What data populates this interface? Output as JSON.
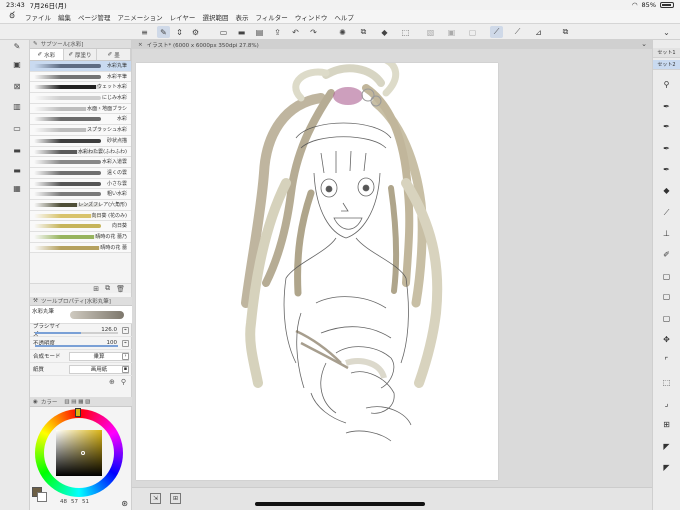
{
  "status_bar": {
    "time": "23:43",
    "date": "7月26日(月)",
    "battery": "85%",
    "wifi_icon": "wifi-icon",
    "battery_icon": "battery-icon"
  },
  "menu": {
    "items": [
      "ファイル",
      "編集",
      "ページ管理",
      "アニメーション",
      "レイヤー",
      "選択範囲",
      "表示",
      "フィルター",
      "ウィンドウ",
      "ヘルプ"
    ]
  },
  "command_bar": {
    "icons": [
      "menu-icon",
      "brush-tool-icon",
      "up-down-icon",
      "settings-icon",
      "new-file-icon",
      "open-folder-icon",
      "save-icon",
      "export-icon",
      "undo-icon",
      "redo-icon",
      "sun-icon",
      "copy-icon",
      "fill-icon",
      "transform-icon",
      "deselect-icon",
      "deselect-icon",
      "crop-icon",
      "pen-icon",
      "pen-icon",
      "ruler-icon",
      "link-icon"
    ]
  },
  "left_tools": [
    "pen-icon",
    "layer-icon",
    "close-box-icon",
    "file-icon",
    "square-icon",
    "folder-icon",
    "folder-icon",
    "gallery-icon"
  ],
  "subtool_panel": {
    "header": "サブツール[水彩]",
    "tabs": [
      {
        "label": "水彩",
        "icon": "brush-icon"
      },
      {
        "label": "厚塗り",
        "icon": "brush-icon"
      },
      {
        "label": "墨",
        "icon": "brush-icon"
      }
    ],
    "brushes": [
      {
        "name": "水彩丸筆",
        "color": "#5e6c83",
        "selected": true
      },
      {
        "name": "水彩平筆",
        "color": "#757575"
      },
      {
        "name": "ウェット水彩",
        "color": "#222222"
      },
      {
        "name": "にじみ水彩",
        "color": "#cfcfcf"
      },
      {
        "name": "水面・地面ブラシ",
        "color": "#bdbdbd"
      },
      {
        "name": "水彩",
        "color": "#6b6b6b"
      },
      {
        "name": "スプラッシュ水彩",
        "color": "#bcbcbc"
      },
      {
        "name": "砂状点描",
        "color": "#3e3e3e"
      },
      {
        "name": "水彩わた雲(ふわふわ)",
        "color": "#5a5a5a"
      },
      {
        "name": "水彩入道雲",
        "color": "#888888"
      },
      {
        "name": "遠くの雲",
        "color": "#6f6f6f"
      },
      {
        "name": "小さな雲",
        "color": "#555555"
      },
      {
        "name": "粗い水彩",
        "color": "#7a7a7a"
      },
      {
        "name": "レンズフレア(六角形)",
        "color": "#4e4e36"
      },
      {
        "name": "向日葵 (花のみ)",
        "color": "#d8c36c"
      },
      {
        "name": "向日葵",
        "color": "#c6b45a"
      },
      {
        "name": "晴時の花 蕾乃",
        "color": "#97b45e"
      },
      {
        "name": "晴時の花 蕾",
        "color": "#b5a15e"
      }
    ]
  },
  "tool_property": {
    "header": "ツールプロパティ[水彩丸筆]",
    "brush_name": "水彩丸筆",
    "rows": [
      {
        "label": "ブラシサイズ",
        "value": "126.0",
        "fill": 0.55
      },
      {
        "label": "不透明度",
        "value": "100",
        "fill": 1.0
      },
      {
        "label": "合成モード",
        "value": "乗算"
      },
      {
        "label": "紙質",
        "value": "画用紙"
      }
    ]
  },
  "color_panel": {
    "header": "カラー",
    "hsv": [
      "48",
      "57",
      "51"
    ],
    "main_color": "#6d5f45"
  },
  "canvas": {
    "doc_title": "イラスト* (6000 x 6000px 350dpi 27.8%)",
    "close_glyph": "×"
  },
  "right_panel": {
    "tabs": [
      "セット1",
      "セット2"
    ],
    "tools": [
      "wand-icon",
      "pen-icon",
      "pen-icon",
      "pen-icon",
      "pen-icon",
      "fill-icon",
      "dropper-icon",
      "stamp-icon",
      "pen-icon",
      "square-icon",
      "square-icon",
      "square-icon",
      "move-icon",
      "corner-icon",
      "select-icon",
      "corner-icon",
      "grid-icon",
      "triangle-icon",
      "triangle-icon"
    ]
  },
  "bottom_bar": {
    "buttons": [
      "transform-icon",
      "fit-icon"
    ]
  }
}
